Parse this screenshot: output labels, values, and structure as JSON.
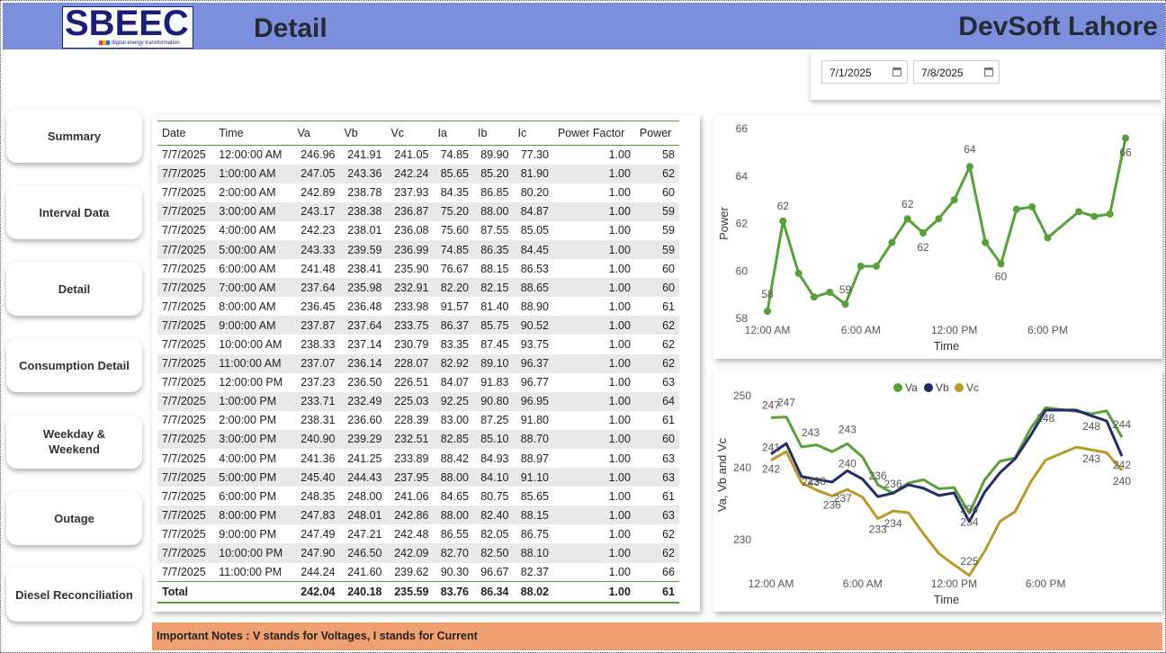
{
  "header": {
    "logo_text": "SBEEC",
    "logo_tagline": "digital energy transformation",
    "page_title": "Detail",
    "brand": "DevSoft Lahore"
  },
  "date_filter": {
    "start": "7/1/2025",
    "end": "7/8/2025"
  },
  "nav": [
    {
      "label": "Summary"
    },
    {
      "label": "Interval Data"
    },
    {
      "label": "Detail"
    },
    {
      "label": "Consumption Detail"
    },
    {
      "label": "Weekday & Weekend"
    },
    {
      "label": "Outage"
    },
    {
      "label": "Diesel Reconciliation"
    }
  ],
  "table": {
    "columns": [
      "Date",
      "Time",
      "Va",
      "Vb",
      "Vc",
      "Ia",
      "Ib",
      "Ic",
      "Power Factor",
      "Power"
    ],
    "rows": [
      [
        "7/7/2025",
        "12:00:00 AM",
        "246.96",
        "241.91",
        "241.05",
        "74.85",
        "89.90",
        "77.30",
        "1.00",
        "58"
      ],
      [
        "7/7/2025",
        "1:00:00 AM",
        "247.05",
        "243.36",
        "242.24",
        "85.65",
        "85.20",
        "81.90",
        "1.00",
        "62"
      ],
      [
        "7/7/2025",
        "2:00:00 AM",
        "242.89",
        "238.78",
        "237.93",
        "84.35",
        "86.85",
        "80.20",
        "1.00",
        "60"
      ],
      [
        "7/7/2025",
        "3:00:00 AM",
        "243.17",
        "238.38",
        "236.87",
        "75.20",
        "88.00",
        "84.87",
        "1.00",
        "59"
      ],
      [
        "7/7/2025",
        "4:00:00 AM",
        "242.23",
        "238.01",
        "236.08",
        "75.60",
        "87.55",
        "85.05",
        "1.00",
        "59"
      ],
      [
        "7/7/2025",
        "5:00:00 AM",
        "243.33",
        "239.59",
        "236.99",
        "74.85",
        "86.35",
        "84.45",
        "1.00",
        "59"
      ],
      [
        "7/7/2025",
        "6:00:00 AM",
        "241.48",
        "238.41",
        "235.90",
        "76.67",
        "88.15",
        "86.53",
        "1.00",
        "60"
      ],
      [
        "7/7/2025",
        "7:00:00 AM",
        "237.64",
        "235.98",
        "232.91",
        "82.20",
        "82.15",
        "88.65",
        "1.00",
        "60"
      ],
      [
        "7/7/2025",
        "8:00:00 AM",
        "236.45",
        "236.48",
        "233.98",
        "91.57",
        "81.40",
        "88.90",
        "1.00",
        "61"
      ],
      [
        "7/7/2025",
        "9:00:00 AM",
        "237.87",
        "237.64",
        "233.75",
        "86.37",
        "85.75",
        "90.52",
        "1.00",
        "62"
      ],
      [
        "7/7/2025",
        "10:00:00 AM",
        "238.33",
        "237.14",
        "230.79",
        "83.35",
        "87.45",
        "93.75",
        "1.00",
        "62"
      ],
      [
        "7/7/2025",
        "11:00:00 AM",
        "237.07",
        "236.14",
        "228.07",
        "82.92",
        "89.10",
        "96.37",
        "1.00",
        "62"
      ],
      [
        "7/7/2025",
        "12:00:00 PM",
        "237.23",
        "236.50",
        "226.51",
        "84.07",
        "91.83",
        "96.77",
        "1.00",
        "63"
      ],
      [
        "7/7/2025",
        "1:00:00 PM",
        "233.71",
        "232.49",
        "225.03",
        "92.25",
        "90.80",
        "96.95",
        "1.00",
        "64"
      ],
      [
        "7/7/2025",
        "2:00:00 PM",
        "238.31",
        "236.60",
        "228.39",
        "83.00",
        "87.25",
        "91.80",
        "1.00",
        "61"
      ],
      [
        "7/7/2025",
        "3:00:00 PM",
        "240.90",
        "239.29",
        "232.51",
        "82.85",
        "85.10",
        "88.70",
        "1.00",
        "60"
      ],
      [
        "7/7/2025",
        "4:00:00 PM",
        "241.36",
        "241.25",
        "233.89",
        "88.42",
        "84.93",
        "88.97",
        "1.00",
        "63"
      ],
      [
        "7/7/2025",
        "5:00:00 PM",
        "245.40",
        "244.43",
        "237.95",
        "88.00",
        "84.10",
        "91.10",
        "1.00",
        "63"
      ],
      [
        "7/7/2025",
        "6:00:00 PM",
        "248.35",
        "248.00",
        "241.06",
        "84.65",
        "80.75",
        "85.65",
        "1.00",
        "61"
      ],
      [
        "7/7/2025",
        "8:00:00 PM",
        "247.83",
        "248.01",
        "242.86",
        "88.00",
        "82.40",
        "88.15",
        "1.00",
        "63"
      ],
      [
        "7/7/2025",
        "9:00:00 PM",
        "247.49",
        "247.21",
        "242.48",
        "86.55",
        "82.05",
        "86.75",
        "1.00",
        "62"
      ],
      [
        "7/7/2025",
        "10:00:00 PM",
        "247.90",
        "246.50",
        "242.09",
        "82.70",
        "82.50",
        "88.10",
        "1.00",
        "62"
      ],
      [
        "7/7/2025",
        "11:00:00 PM",
        "244.24",
        "241.60",
        "239.62",
        "90.30",
        "96.67",
        "82.37",
        "1.00",
        "66"
      ]
    ],
    "total": [
      "Total",
      "",
      "242.04",
      "240.18",
      "235.59",
      "83.76",
      "86.34",
      "88.02",
      "1.00",
      "61"
    ]
  },
  "chart_data": [
    {
      "type": "line",
      "xlabel": "Time",
      "ylabel": "Power",
      "x_tick_labels": [
        "12:00 AM",
        "6:00 AM",
        "12:00 PM",
        "6:00 PM"
      ],
      "x_hours": [
        0,
        1,
        2,
        3,
        4,
        5,
        6,
        7,
        8,
        9,
        10,
        11,
        12,
        13,
        14,
        15,
        16,
        17,
        18,
        20,
        21,
        22,
        23
      ],
      "ylim": [
        58,
        66
      ],
      "y_ticks": [
        58,
        60,
        62,
        64,
        66
      ],
      "color": "#5aa03a",
      "series": [
        {
          "values": [
            58.3,
            62.1,
            59.9,
            58.9,
            59.1,
            58.6,
            60.2,
            60.2,
            61.2,
            62.2,
            61.6,
            62.2,
            63.0,
            64.4,
            61.2,
            60.3,
            62.6,
            62.7,
            61.4,
            62.5,
            62.3,
            62.4,
            65.6
          ]
        }
      ],
      "data_labels": [
        {
          "index": 0,
          "text": "58"
        },
        {
          "index": 1,
          "text": "62"
        },
        {
          "index": 5,
          "text": "59"
        },
        {
          "index": 9,
          "text": "62"
        },
        {
          "index": 10,
          "text": "62"
        },
        {
          "index": 13,
          "text": "64"
        },
        {
          "index": 15,
          "text": "60"
        },
        {
          "index": 22,
          "text": "66"
        }
      ]
    },
    {
      "type": "line",
      "xlabel": "Time",
      "ylabel": "Va, Vb and Vc",
      "x_tick_labels": [
        "12:00 AM",
        "6:00 AM",
        "12:00 PM",
        "6:00 PM"
      ],
      "x_hours": [
        0,
        1,
        2,
        3,
        4,
        5,
        6,
        7,
        8,
        9,
        10,
        11,
        12,
        13,
        14,
        15,
        16,
        17,
        18,
        20,
        21,
        22,
        23
      ],
      "ylim": [
        226,
        252
      ],
      "y_ticks": [
        230,
        240,
        250
      ],
      "legend": "top",
      "series": [
        {
          "name": "Va",
          "color": "#5aa03a",
          "values": [
            246.96,
            247.05,
            242.89,
            243.17,
            242.23,
            243.33,
            241.48,
            237.64,
            236.45,
            237.87,
            238.33,
            237.07,
            237.23,
            233.71,
            238.31,
            240.9,
            241.36,
            245.4,
            248.35,
            247.83,
            247.49,
            247.9,
            244.24
          ]
        },
        {
          "name": "Vb",
          "color": "#252a6a",
          "values": [
            241.91,
            243.36,
            238.78,
            238.38,
            238.01,
            239.59,
            238.41,
            235.98,
            236.48,
            237.64,
            237.14,
            236.14,
            236.5,
            232.49,
            236.6,
            239.29,
            241.25,
            244.43,
            248.0,
            248.01,
            247.21,
            246.5,
            241.6
          ]
        },
        {
          "name": "Vc",
          "color": "#b89a2a",
          "values": [
            241.05,
            242.24,
            237.93,
            236.87,
            236.08,
            236.99,
            235.9,
            232.91,
            233.98,
            233.75,
            230.79,
            228.07,
            226.51,
            225.03,
            228.39,
            232.51,
            233.89,
            237.95,
            241.06,
            242.86,
            242.48,
            242.09,
            239.62
          ]
        }
      ],
      "data_labels": [
        {
          "series": 0,
          "index": 0,
          "text": "247"
        },
        {
          "series": 0,
          "index": 1,
          "text": "247"
        },
        {
          "series": 1,
          "index": 0,
          "text": "241"
        },
        {
          "series": 2,
          "index": 0,
          "text": "242"
        },
        {
          "series": 0,
          "index": 2,
          "text": "243"
        },
        {
          "series": 1,
          "index": 2,
          "text": "243"
        },
        {
          "series": 0,
          "index": 5,
          "text": "243"
        },
        {
          "series": 1,
          "index": 5,
          "text": "240"
        },
        {
          "series": 2,
          "index": 5,
          "text": "237"
        },
        {
          "series": 2,
          "index": 3,
          "text": "238"
        },
        {
          "series": 2,
          "index": 4,
          "text": "236"
        },
        {
          "series": 0,
          "index": 7,
          "text": "236"
        },
        {
          "series": 2,
          "index": 7,
          "text": "233"
        },
        {
          "series": 1,
          "index": 8,
          "text": "236"
        },
        {
          "series": 2,
          "index": 8,
          "text": "234"
        },
        {
          "series": 1,
          "index": 13,
          "text": "234"
        },
        {
          "series": 0,
          "index": 13,
          "text": "234"
        },
        {
          "series": 2,
          "index": 13,
          "text": "225"
        },
        {
          "series": 0,
          "index": 18,
          "text": "248"
        },
        {
          "series": 0,
          "index": 20,
          "text": "248"
        },
        {
          "series": 2,
          "index": 20,
          "text": "243"
        },
        {
          "series": 0,
          "index": 22,
          "text": "244"
        },
        {
          "series": 1,
          "index": 22,
          "text": "242"
        },
        {
          "series": 2,
          "index": 22,
          "text": "240"
        }
      ]
    }
  ],
  "notes": "Important Notes : V stands for Voltages, I stands for Current"
}
